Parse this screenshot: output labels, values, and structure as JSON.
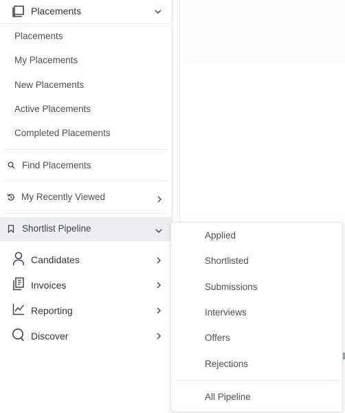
{
  "sidebar": {
    "section": {
      "title": "Placements",
      "icon": "book-icon",
      "expanded": true
    },
    "sub_items": [
      {
        "label": "Placements"
      },
      {
        "label": "My Placements"
      },
      {
        "label": "New Placements"
      },
      {
        "label": "Active Placements"
      },
      {
        "label": "Completed Placements"
      }
    ],
    "find": {
      "label": "Find Placements",
      "icon": "search-icon"
    },
    "recent": {
      "label": "My Recently Viewed",
      "icon": "history-icon"
    },
    "pipeline": {
      "label": "Shortlist Pipeline",
      "icon": "bookmark-icon",
      "active": true
    },
    "nav": [
      {
        "label": "Candidates",
        "icon": "person-icon"
      },
      {
        "label": "Invoices",
        "icon": "invoice-icon"
      },
      {
        "label": "Reporting",
        "icon": "chart-icon"
      },
      {
        "label": "Discover",
        "icon": "discover-icon"
      }
    ]
  },
  "flyout": {
    "items": [
      {
        "label": "Applied"
      },
      {
        "label": "Shortlisted"
      },
      {
        "label": "Submissions"
      },
      {
        "label": "Interviews"
      },
      {
        "label": "Offers"
      },
      {
        "label": "Rejections"
      }
    ],
    "footer": {
      "label": "All Pipeline"
    }
  },
  "colors": {
    "text": "#3c4250",
    "muted": "#4a505c",
    "active_bg": "#eceef1",
    "border": "#e3e5e9"
  }
}
